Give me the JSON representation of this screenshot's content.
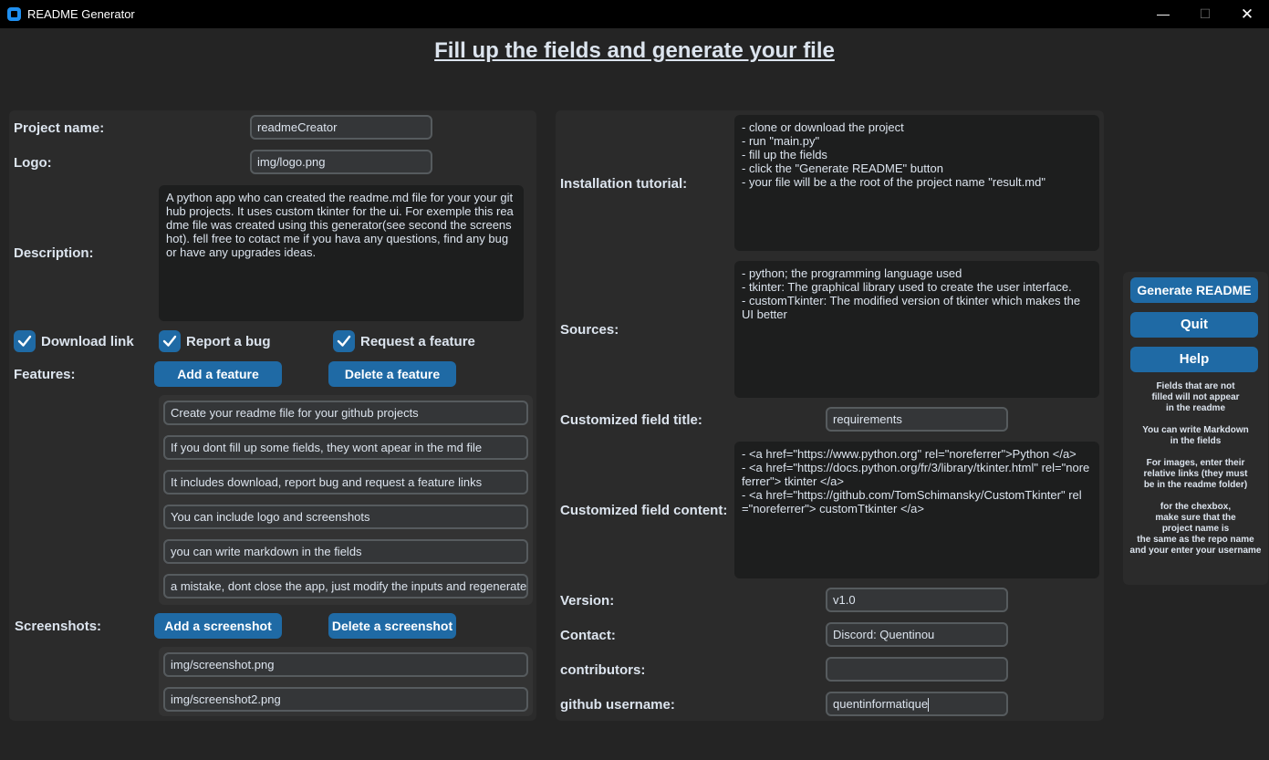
{
  "window": {
    "title": "README Generator",
    "minimize": "—",
    "maximize": "☐",
    "close": "✕"
  },
  "page": {
    "title": "Fill up the fields and generate your file"
  },
  "colors": {
    "accent": "#1f6aa5",
    "background": "#242424",
    "frame": "#2b2b2b"
  },
  "left": {
    "project_name": {
      "label": "Project name:",
      "value": "readmeCreator"
    },
    "logo": {
      "label": "Logo:",
      "value": "img/logo.png"
    },
    "description": {
      "label": "Description:",
      "value": "A python app who can created the readme.md file for your your github projects. It uses custom tkinter for the ui. For exemple this readme file was created using this generator(see second the screenshot). fell free to cotact me if you hava any questions, find any bug or have any upgrades ideas."
    },
    "checkboxes": [
      {
        "label": "Download link",
        "checked": true
      },
      {
        "label": "Report a bug",
        "checked": true
      },
      {
        "label": "Request a feature",
        "checked": true
      }
    ],
    "features": {
      "label": "Features:",
      "add": "Add a feature",
      "delete": "Delete a feature",
      "items": [
        "Create your readme file for your github projects",
        "If you dont fill up some fields, they wont apear in the md file",
        "It includes download, report bug and request a feature links",
        "You can include logo and screenshots",
        "you can write markdown in the fields",
        " a mistake, dont close the app, just modify the inputs and regenerate"
      ]
    },
    "screenshots": {
      "label": "Screenshots:",
      "add": "Add a screenshot",
      "delete": "Delete a screenshot",
      "items": [
        "img/screenshot.png",
        "img/screenshot2.png"
      ]
    }
  },
  "mid": {
    "installation": {
      "label": "Installation tutorial:",
      "value": "- clone or download the project\n- run \"main.py\"\n- fill up the fields\n- click the \"Generate README\" button\n- your file will be a the root of the project name \"result.md\""
    },
    "sources": {
      "label": "Sources:",
      "value": "- python; the programming language used\n- tkinter: The graphical library used to create the user interface.\n- customTkinter: The modified version of tkinter which makes the UI better"
    },
    "custom_title": {
      "label": "Customized field title:",
      "value": "requirements"
    },
    "custom_content": {
      "label": "Customized field content:",
      "value": "- <a href=\"https://www.python.org\" rel=\"noreferrer\">Python </a>\n- <a href=\"https://docs.python.org/fr/3/library/tkinter.html\" rel=\"noreferrer\"> tkinter </a>\n- <a href=\"https://github.com/TomSchimansky/CustomTkinter\" rel=\"noreferrer\"> customTtkinter </a>"
    },
    "version": {
      "label": "Version:",
      "value": "v1.0"
    },
    "contact": {
      "label": "Contact:",
      "value": "Discord: Quentinou"
    },
    "contributors": {
      "label": "contributors:",
      "value": ""
    },
    "github": {
      "label": "github username:",
      "value": "quentinformatique"
    }
  },
  "right": {
    "generate": "Generate README",
    "quit": "Quit",
    "help": "Help",
    "help_text": "Fields that are not\nfilled will not appear\nin the readme\n\nYou can write Markdown\nin the fields\n\nFor images, enter their\nrelative links (they must\nbe in the readme folder)\n\nfor the chexbox,\nmake sure that the\nproject name is\nthe same as the repo name\nand your enter your username"
  }
}
